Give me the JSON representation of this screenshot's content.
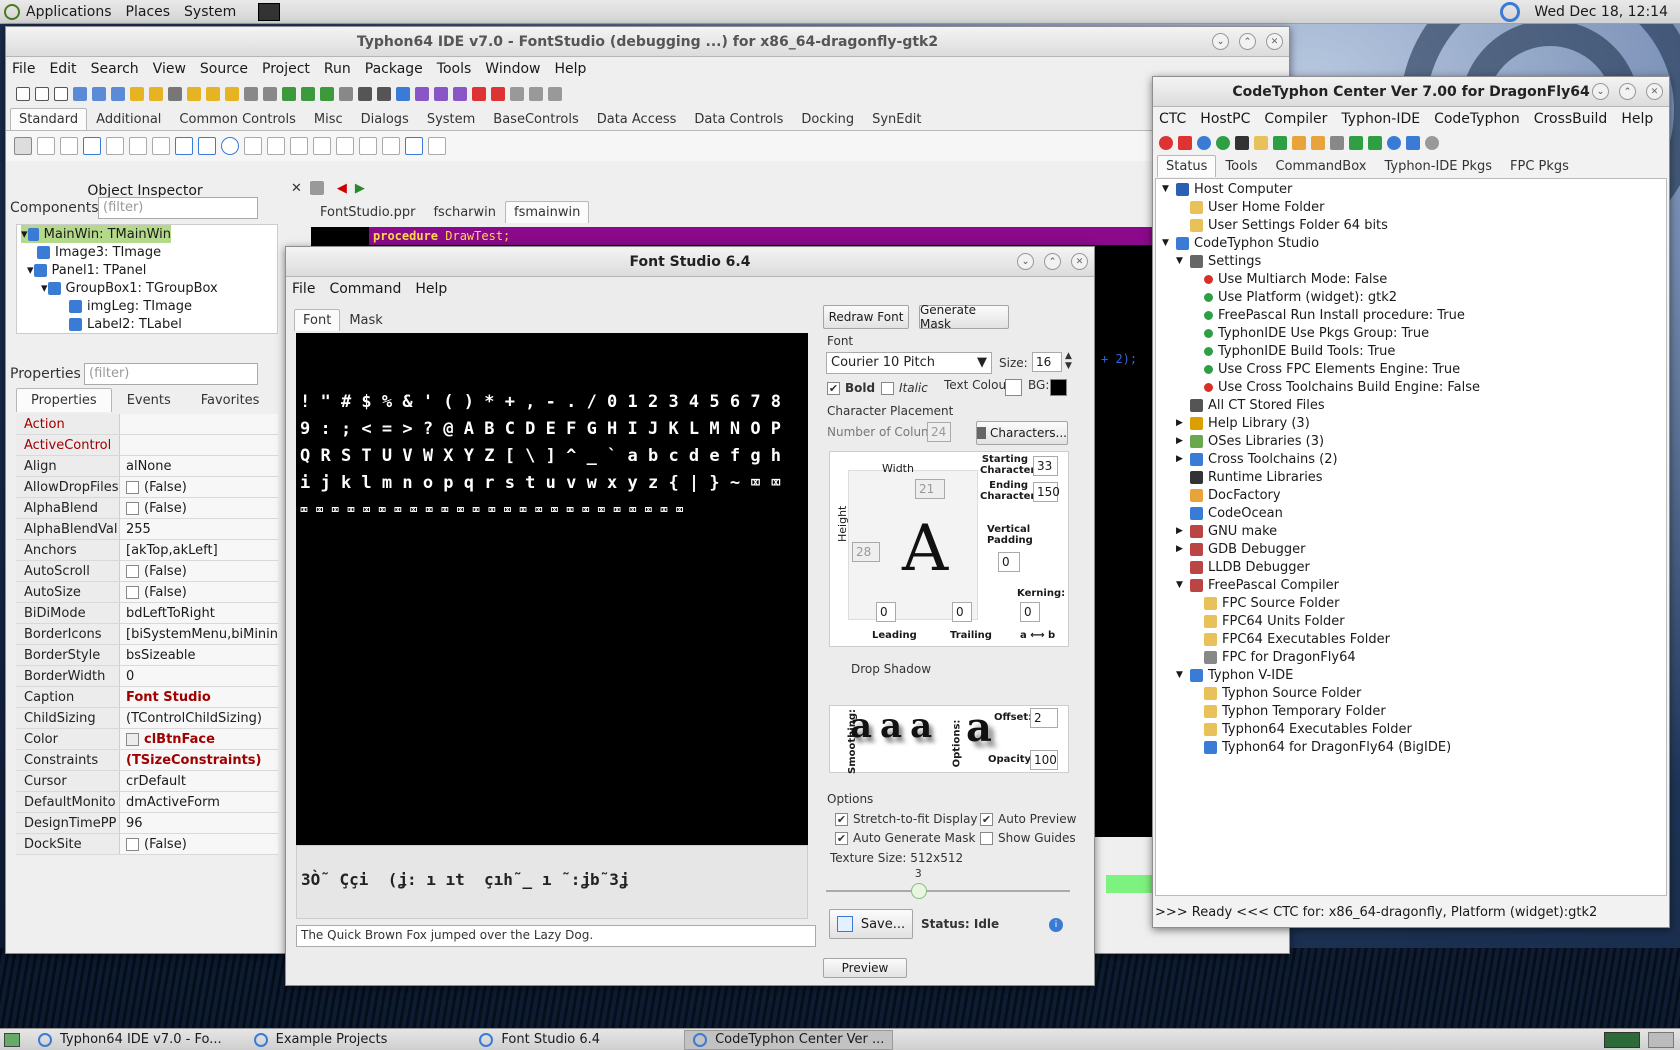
{
  "panel": {
    "apps": "Applications",
    "places": "Places",
    "system": "System",
    "clock": "Wed Dec 18, 12:14"
  },
  "ide": {
    "title": "Typhon64 IDE v7.0 - FontStudio (debugging ...) for x86_64-dragonfly-gtk2",
    "menu": [
      "File",
      "Edit",
      "Search",
      "View",
      "Source",
      "Project",
      "Run",
      "Package",
      "Tools",
      "Window",
      "Help"
    ],
    "palette_tabs": [
      "Standard",
      "Additional",
      "Common Controls",
      "Misc",
      "Dialogs",
      "System",
      "BaseControls",
      "Data Access",
      "Data Controls",
      "Docking",
      "SynEdit"
    ],
    "editor_tabs": [
      "FontStudio.ppr",
      "fscharwin",
      "fsmainwin"
    ],
    "code_keyword": "procedure",
    "code_text": " DrawTest;",
    "code_frag": "+ 2);"
  },
  "inspector": {
    "title": "Object Inspector",
    "components_label": "Components",
    "filter_placeholder": "(filter)",
    "properties_label": "Properties",
    "tree": [
      "MainWin: TMainWin",
      "Image3: TImage",
      "Panel1: TPanel",
      "GroupBox1: TGroupBox",
      "imgLeg: TImage",
      "Label2: TLabel"
    ],
    "tabs": [
      "Properties",
      "Events",
      "Favorites"
    ],
    "props": [
      [
        "Action",
        ""
      ],
      [
        "ActiveControl",
        ""
      ],
      [
        "Align",
        "alNone"
      ],
      [
        "AllowDropFiles",
        "(False)"
      ],
      [
        "AlphaBlend",
        "(False)"
      ],
      [
        "AlphaBlendVal",
        "255"
      ],
      [
        "Anchors",
        "[akTop,akLeft]"
      ],
      [
        "AutoScroll",
        "(False)"
      ],
      [
        "AutoSize",
        "(False)"
      ],
      [
        "BiDiMode",
        "bdLeftToRight"
      ],
      [
        "BorderIcons",
        "[biSystemMenu,biMinin"
      ],
      [
        "BorderStyle",
        "bsSizeable"
      ],
      [
        "BorderWidth",
        "0"
      ],
      [
        "Caption",
        "Font Studio"
      ],
      [
        "ChildSizing",
        "(TControlChildSizing)"
      ],
      [
        "Color",
        "clBtnFace"
      ],
      [
        "Constraints",
        "(TSizeConstraints)"
      ],
      [
        "Cursor",
        "crDefault"
      ],
      [
        "DefaultMonito",
        "dmActiveForm"
      ],
      [
        "DesignTimePP",
        "96"
      ],
      [
        "DockSite",
        "(False)"
      ]
    ]
  },
  "fs": {
    "title": "Font Studio 6.4",
    "menu": [
      "File",
      "Command",
      "Help"
    ],
    "tabs": [
      "Font",
      "Mask"
    ],
    "glyph_rows": [
      "! \" # $ % & ' ( ) * + , - . / 0 1 2 3 4 5 6 7 8",
      "9 : ; < = > ? @ A B C D E F G H I J K L M N O P",
      "Q R S T U V W X Y Z [ \\ ] ^ _ ` a b c d e f g h",
      "i j k l m n o p q r s t u v w x y z { | } ~ ⌧ ⌧",
      "⌧ ⌧ ⌧ ⌧ ⌧ ⌧ ⌧ ⌧ ⌧ ⌧ ⌧ ⌧ ⌧ ⌧ ⌧ ⌧ ⌧ ⌧ ⌧ ⌧ ⌧ ⌧ ⌧ ⌧ ⌧"
    ],
    "preview_glyphs": "3Ò˜ Ççi  (ʝ: ı ıt  çıh˜_ ı ˜:ʝb˜3ʝ",
    "sample_text": "The Quick Brown Fox jumped over the Lazy Dog.",
    "redraw": "Redraw Font",
    "genmask": "Generate Mask",
    "font_label": "Font",
    "font_name": "Courier 10 Pitch",
    "size_label": "Size:",
    "size": "16",
    "bold": "Bold",
    "italic": "Italic",
    "text_colour": "Text Colour",
    "bg": "BG:",
    "char_place": "Character Placement",
    "num_cols": "Number of Colun",
    "num_cols_val": "24",
    "characters": "Characters...",
    "width": "Width",
    "width_val": "21",
    "height": "Height",
    "height_val": "28",
    "start_char": "Starting Character",
    "start_val": "33",
    "end_char": "Ending Character",
    "end_val": "150",
    "vpad": "Vertical Padding",
    "vpad_val": "0",
    "kerning": "Kerning:",
    "leading": "Leading",
    "trailing": "Trailing",
    "ab": "a ⟷ b",
    "zero": "0",
    "big_a": "A",
    "drop_shadow": "Drop Shadow",
    "smoothing": "Smoothing:",
    "opts_side": "Options:",
    "offset": "Offset:",
    "offset_val": "2",
    "opacity": "Opacity:",
    "opacity_val": "100",
    "shadow_glyph": "a",
    "options": "Options",
    "stretch": "Stretch-to-fit Display",
    "autopreview": "Auto Preview",
    "autogen": "Auto Generate Mask",
    "showguides": "Show Guides",
    "texsize": "Texture Size: 512x512",
    "slider_val": "3",
    "slider_fraction": 0.38,
    "save": "Save...",
    "status": "Status: Idle",
    "preview": "Preview"
  },
  "ctc": {
    "title": "CodeTyphon Center Ver 7.00 for DragonFly64",
    "menu": [
      "CTC",
      "HostPC",
      "Compiler",
      "Typhon-IDE",
      "CodeTyphon",
      "CrossBuild",
      "Help"
    ],
    "tabs": [
      "Status",
      "Tools",
      "CommandBox",
      "Typhon-IDE Pkgs",
      "FPC Pkgs"
    ],
    "tree": [
      [
        0,
        "▼",
        "Host Computer",
        "#2b5fb3"
      ],
      [
        1,
        "",
        "User Home Folder",
        "#e8c15a"
      ],
      [
        1,
        "",
        "User Settings Folder 64 bits",
        "#e8c15a"
      ],
      [
        0,
        "▼",
        "CodeTyphon Studio",
        "#3a7bd5"
      ],
      [
        1,
        "▼",
        "Settings",
        "#666"
      ],
      [
        2,
        "",
        "Use Multiarch Mode: False",
        "#d93025"
      ],
      [
        2,
        "",
        "Use Platform (widget): gtk2",
        "#2ea043"
      ],
      [
        2,
        "",
        "FreePascal Run Install procedure: True",
        "#2ea043"
      ],
      [
        2,
        "",
        "TyphonIDE Use Pkgs Group: True",
        "#2ea043"
      ],
      [
        2,
        "",
        "TyphonIDE Build Tools: True",
        "#2ea043"
      ],
      [
        2,
        "",
        "Use Cross FPC Elements Engine: True",
        "#2ea043"
      ],
      [
        2,
        "",
        "Use Cross Toolchains Build Engine: False",
        "#d93025"
      ],
      [
        1,
        "",
        "All CT Stored Files",
        "#555"
      ],
      [
        1,
        "▶",
        "Help Library (3)",
        "#d9a000"
      ],
      [
        1,
        "▶",
        "OSes Libraries (3)",
        "#6aa84f"
      ],
      [
        1,
        "▶",
        "Cross Toolchains (2)",
        "#3a7bd5"
      ],
      [
        1,
        "",
        "Runtime Libraries",
        "#333"
      ],
      [
        1,
        "",
        "DocFactory",
        "#e8a33d"
      ],
      [
        1,
        "",
        "CodeOcean",
        "#3a7bd5"
      ],
      [
        1,
        "▶",
        "GNU make",
        "#b44"
      ],
      [
        1,
        "▶",
        "GDB Debugger",
        "#b44"
      ],
      [
        1,
        "",
        "LLDB Debugger",
        "#b44"
      ],
      [
        1,
        "▼",
        "FreePascal Compiler",
        "#b44"
      ],
      [
        2,
        "",
        "FPC Source Folder",
        "#e8c15a"
      ],
      [
        2,
        "",
        "FPC64 Units Folder",
        "#e8c15a"
      ],
      [
        2,
        "",
        "FPC64 Executables Folder",
        "#e8c15a"
      ],
      [
        2,
        "",
        "FPC for DragonFly64",
        "#888"
      ],
      [
        1,
        "▼",
        "Typhon V-IDE",
        "#3a7bd5"
      ],
      [
        2,
        "",
        "Typhon Source Folder",
        "#e8c15a"
      ],
      [
        2,
        "",
        "Typhon Temporary Folder",
        "#e8c15a"
      ],
      [
        2,
        "",
        "Typhon64 Executables Folder",
        "#e8c15a"
      ],
      [
        2,
        "",
        "Typhon64 for DragonFly64 (BigIDE)",
        "#3a7bd5"
      ]
    ],
    "status": ">>> Ready <<<  CTC for: x86_64-dragonfly, Platform (widget):gtk2"
  },
  "taskbar": [
    "Typhon64 IDE v7.0 - Fo...",
    "Example Projects",
    "Font Studio 6.4",
    "CodeTyphon Center Ver ..."
  ]
}
